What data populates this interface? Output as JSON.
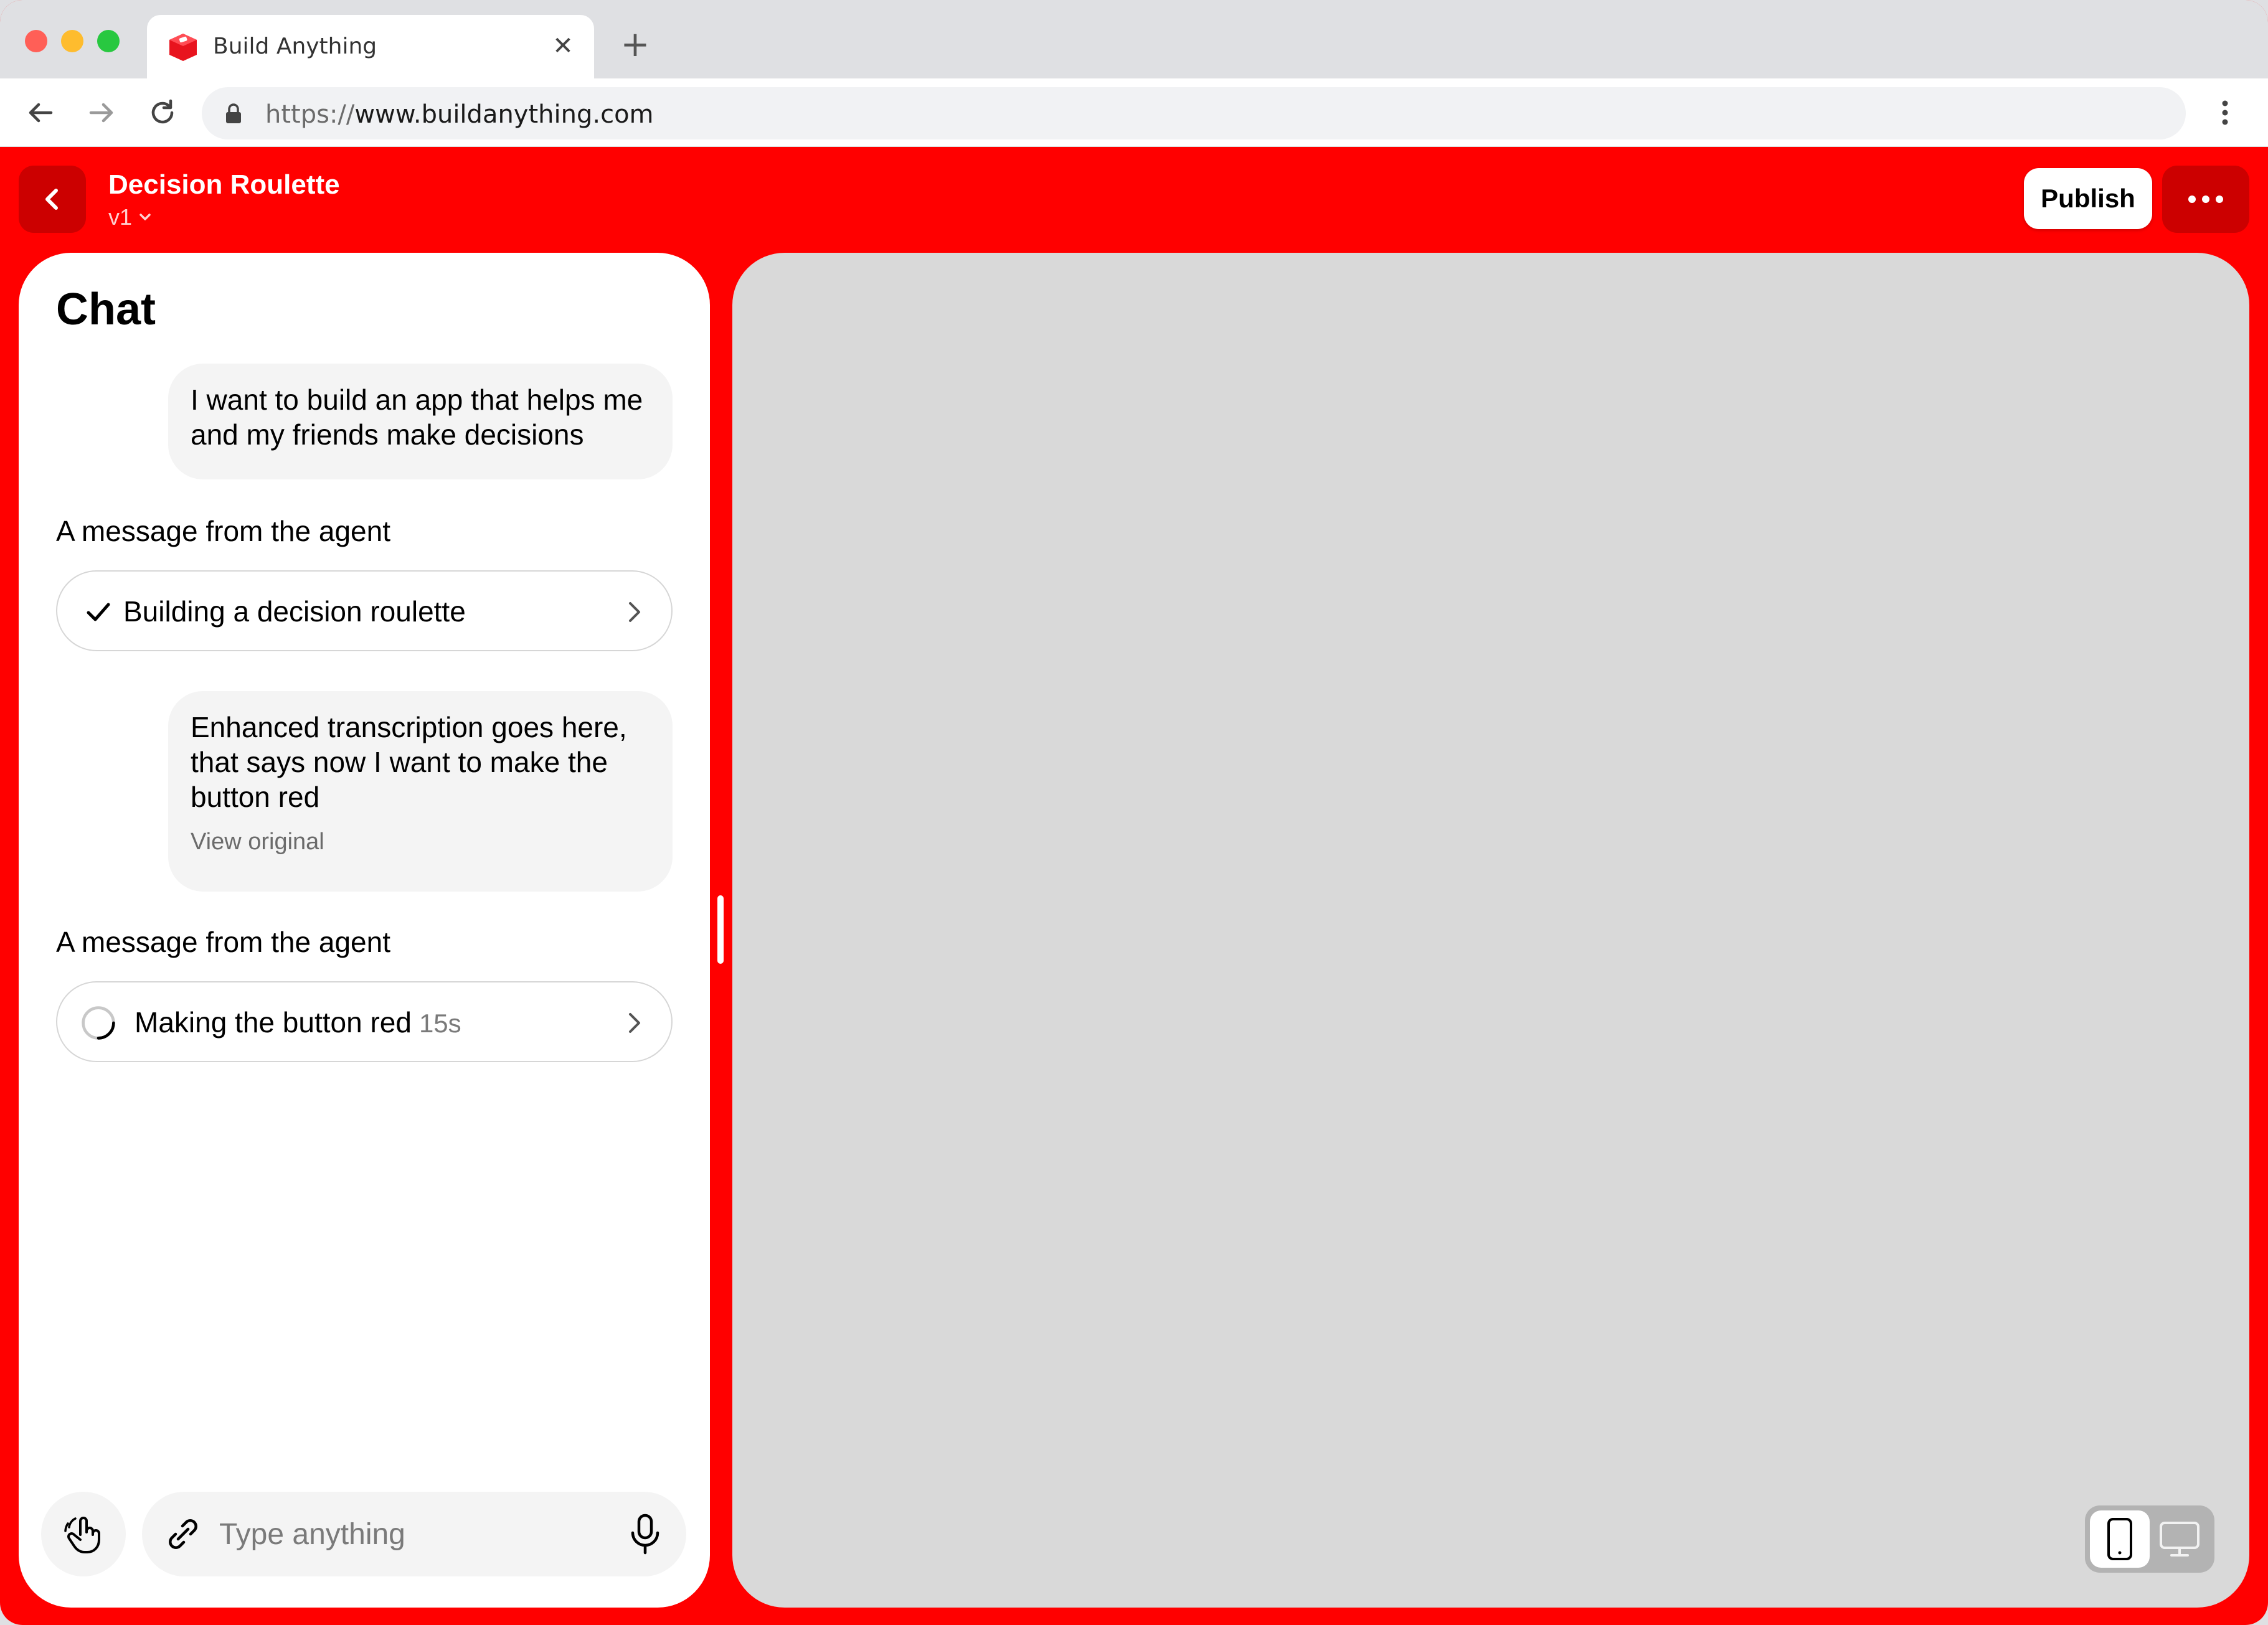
{
  "browser": {
    "tab_title": "Build Anything",
    "tab_close": "✕",
    "new_tab": "+",
    "url_scheme": "https://",
    "url_host": "www.buildanything.com"
  },
  "header": {
    "project_title": "Decision Roulette",
    "version": "v1",
    "publish_label": "Publish"
  },
  "chat": {
    "heading": "Chat",
    "messages": [
      {
        "role": "user",
        "text": "I want to build an app that helps me and my friends make decisions"
      },
      {
        "role": "agent",
        "label": "A message from the agent",
        "task": "Building a decision roulette",
        "status": "done"
      },
      {
        "role": "user",
        "text": "Enhanced transcription goes here, that says now I want to make the button red",
        "link": "View original"
      },
      {
        "role": "agent",
        "label": "A message from the agent",
        "task": "Making the button red",
        "elapsed": "15s",
        "status": "in-progress"
      }
    ],
    "input": {
      "placeholder": "Type anything",
      "value": ""
    }
  },
  "icons": {
    "nav_back": "arrow-left-icon",
    "nav_forward": "arrow-right-icon",
    "reload": "reload-icon",
    "lock": "lock-icon",
    "menu": "vertical-dots-icon",
    "gesture": "hand-pointer-icon",
    "attach": "paperclip-icon",
    "mic": "microphone-icon",
    "mobile": "mobile-device-icon",
    "desktop": "desktop-monitor-icon"
  },
  "colors": {
    "brand": "#ff0000",
    "brand_dark": "#cc0000",
    "panel": "#ffffff",
    "preview": "#d9d9d9"
  }
}
